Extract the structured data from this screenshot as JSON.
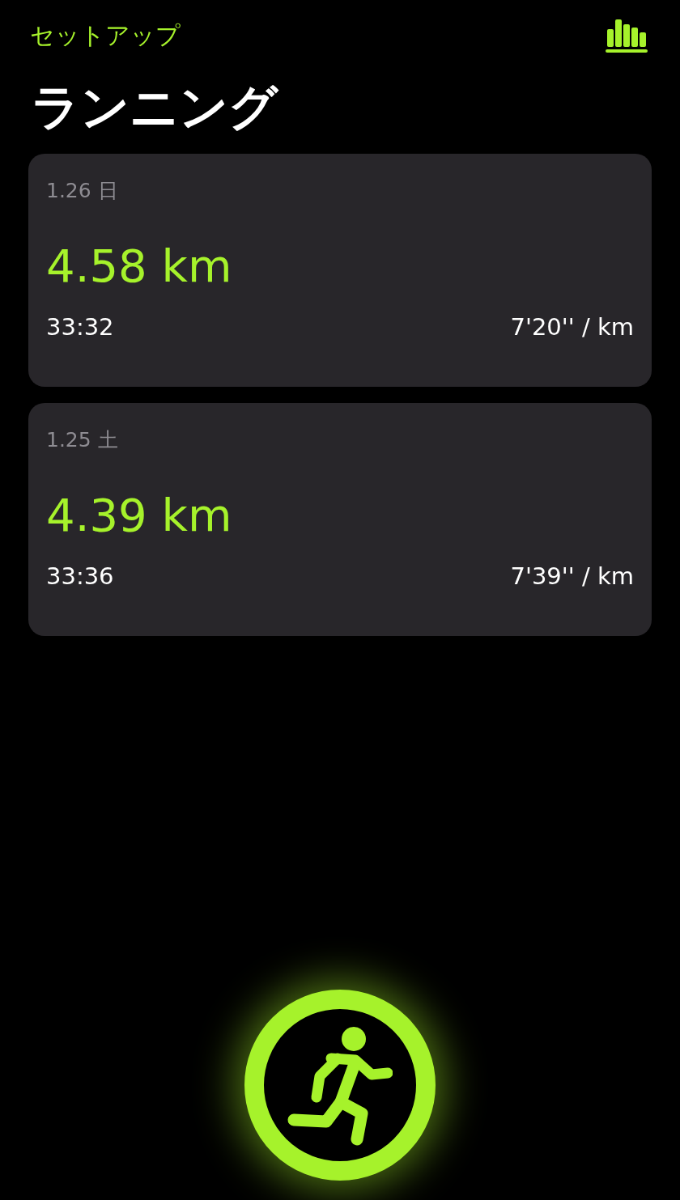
{
  "header": {
    "back_label": "セットアップ",
    "title": "ランニング"
  },
  "workouts": [
    {
      "date": "1.26 日",
      "distance": "4.58 km",
      "duration": "33:32",
      "pace": "7'20'' / km"
    },
    {
      "date": "1.25 土",
      "distance": "4.39 km",
      "duration": "33:36",
      "pace": "7'39'' / km"
    }
  ]
}
